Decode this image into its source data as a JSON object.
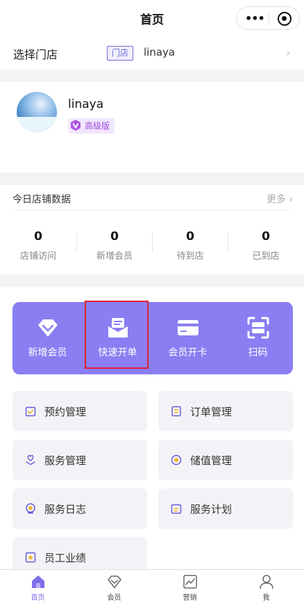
{
  "header": {
    "title": "首页",
    "more_icon": "more-dots-icon",
    "target_icon": "target-circle-icon"
  },
  "store": {
    "label": "选择门店",
    "tag": "门店",
    "name": "linaya",
    "chevron": "›"
  },
  "profile": {
    "name": "linaya",
    "badge": "高级版",
    "badge_icon": "v-badge-icon"
  },
  "stats": {
    "title": "今日店铺数据",
    "more": "更多 ›",
    "items": [
      {
        "value": "0",
        "label": "店铺访问"
      },
      {
        "value": "0",
        "label": "新增会员"
      },
      {
        "value": "0",
        "label": "待到店"
      },
      {
        "value": "0",
        "label": "已到店"
      }
    ]
  },
  "quick_actions": [
    {
      "label": "新增会员",
      "icon": "diamond-icon"
    },
    {
      "label": "快速开单",
      "icon": "envelope-order-icon"
    },
    {
      "label": "会员开卡",
      "icon": "card-icon"
    },
    {
      "label": "扫码",
      "icon": "scan-icon"
    }
  ],
  "menu": [
    {
      "label": "预约管理",
      "icon": "calendar-check-icon"
    },
    {
      "label": "订单管理",
      "icon": "order-list-icon"
    },
    {
      "label": "服务管理",
      "icon": "heart-hand-icon"
    },
    {
      "label": "储值管理",
      "icon": "coin-icon"
    },
    {
      "label": "服务日志",
      "icon": "log-coin-icon"
    },
    {
      "label": "服务计划",
      "icon": "plan-calendar-icon"
    },
    {
      "label": "员工业绩",
      "icon": "performance-icon"
    }
  ],
  "tabs": [
    {
      "label": "首页",
      "icon": "home-icon",
      "active": true
    },
    {
      "label": "会员",
      "icon": "member-diamond-icon",
      "active": false
    },
    {
      "label": "营销",
      "icon": "marketing-chart-icon",
      "active": false
    },
    {
      "label": "我",
      "icon": "user-icon",
      "active": false
    }
  ],
  "colors": {
    "accent": "#8a7ef2",
    "tag": "#6f6cd6",
    "badge": "#a24bd8",
    "icon": "#6a5bd6",
    "highlight": "#e3202f"
  }
}
